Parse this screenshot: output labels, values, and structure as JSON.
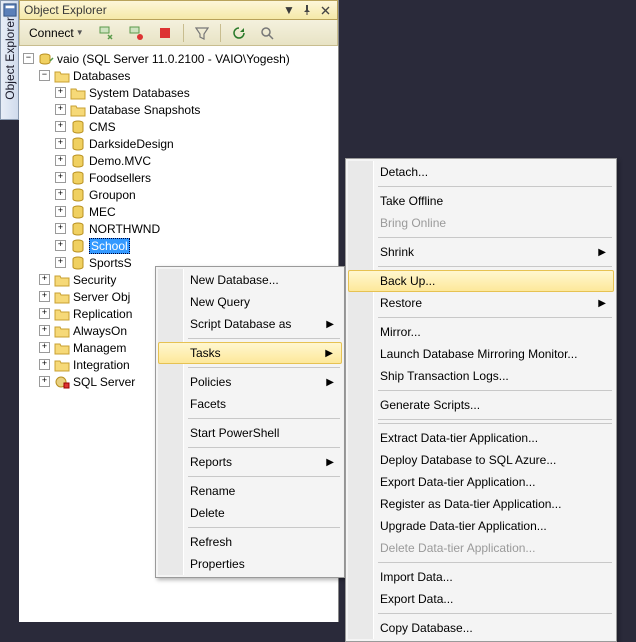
{
  "panel": {
    "title": "Object Explorer"
  },
  "sidebar_tab": "Object Explorer",
  "toolbar": {
    "connect": "Connect"
  },
  "tree": {
    "server": "vaio (SQL Server 11.0.2100 - VAIO\\Yogesh)",
    "databases_folder": "Databases",
    "items": {
      "sysdb": "System Databases",
      "snapshots": "Database Snapshots",
      "cms": "CMS",
      "darkside": "DarksideDesign",
      "demo": "Demo.MVC",
      "foodsellers": "Foodsellers",
      "groupon": "Groupon",
      "mec": "MEC",
      "northwnd": "NORTHWND",
      "school": "School",
      "sportsstore": "SportsS"
    },
    "security": "Security",
    "serverobj": "Server Obj",
    "replication": "Replication",
    "alwayson": "AlwaysOn",
    "management": "Managem",
    "integration": "Integration",
    "sqlagent": "SQL Server"
  },
  "ctx1": {
    "new_db": "New Database...",
    "new_query": "New Query",
    "script_db": "Script Database as",
    "tasks": "Tasks",
    "policies": "Policies",
    "facets": "Facets",
    "powershell": "Start PowerShell",
    "reports": "Reports",
    "rename": "Rename",
    "delete": "Delete",
    "refresh": "Refresh",
    "properties": "Properties"
  },
  "ctx2": {
    "detach": "Detach...",
    "take_offline": "Take Offline",
    "bring_online": "Bring Online",
    "shrink": "Shrink",
    "backup": "Back Up...",
    "restore": "Restore",
    "mirror": "Mirror...",
    "launch_mirror": "Launch Database Mirroring Monitor...",
    "ship_logs": "Ship Transaction Logs...",
    "gen_scripts": "Generate Scripts...",
    "extract_dt": "Extract Data-tier Application...",
    "deploy_azure": "Deploy Database to SQL Azure...",
    "export_dt": "Export Data-tier Application...",
    "register_dt": "Register as Data-tier Application...",
    "upgrade_dt": "Upgrade Data-tier Application...",
    "delete_dt": "Delete Data-tier Application...",
    "import_data": "Import Data...",
    "export_data": "Export Data...",
    "copy_db": "Copy Database..."
  }
}
